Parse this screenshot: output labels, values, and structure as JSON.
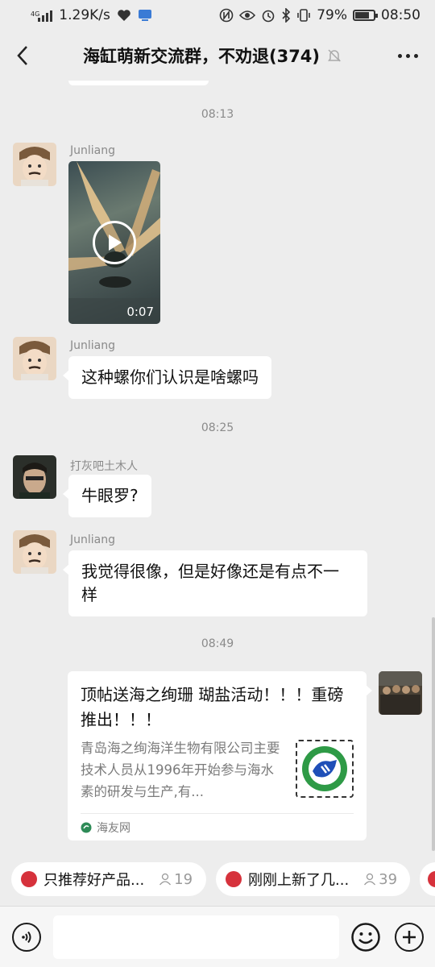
{
  "status_bar": {
    "network_type": "4G",
    "speed": "1.29K/s",
    "battery_percent": "79%",
    "battery_level": 0.79,
    "time": "08:50"
  },
  "header": {
    "title": "海缸萌新交流群，不劝退(374)",
    "back_icon": "chevron-left-icon",
    "mute_icon": "bell-off-icon",
    "more_icon": "more-dots-icon"
  },
  "messages": [
    {
      "type": "timestamp",
      "text": "08:13"
    },
    {
      "type": "video",
      "sender": "Junliang",
      "duration": "0:07"
    },
    {
      "type": "text",
      "sender": "Junliang",
      "text": "这种螺你们认识是啥螺吗"
    },
    {
      "type": "timestamp",
      "text": "08:25"
    },
    {
      "type": "text",
      "sender": "打灰吧土木人",
      "text": "牛眼罗?"
    },
    {
      "type": "text",
      "sender": "Junliang",
      "text": "我觉得很像，但是好像还是有点不一样"
    },
    {
      "type": "timestamp",
      "text": "08:49"
    },
    {
      "type": "link_card",
      "title": "顶帖送海之绚珊 瑚盐活动！！！重磅推出！！！",
      "body": "青岛海之绚海洋生物有限公司主要技术人员从1996年开始参与海水素的研发与生产,有...",
      "source": "海友网"
    }
  ],
  "pinned": [
    {
      "label": "只推荐好产品...",
      "count": "19"
    },
    {
      "label": "刚刚上新了几...",
      "count": "39"
    }
  ],
  "input": {
    "placeholder": ""
  },
  "colors": {
    "background": "#ededed",
    "bubble": "#ffffff",
    "pin_accent": "#d6323c"
  }
}
